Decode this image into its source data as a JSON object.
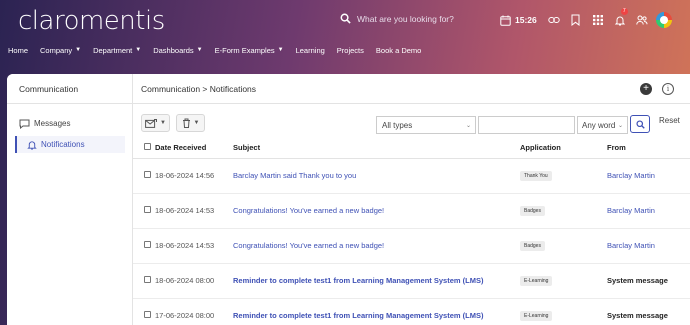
{
  "app": {
    "logo_text": "claromentis",
    "search_placeholder": "What are you looking for?",
    "clock_time": "15:26",
    "notification_count": "7"
  },
  "nav": {
    "items": [
      {
        "label": "Home",
        "has_menu": false
      },
      {
        "label": "Company",
        "has_menu": true
      },
      {
        "label": "Department",
        "has_menu": true
      },
      {
        "label": "Dashboards",
        "has_menu": true
      },
      {
        "label": "E-Form Examples",
        "has_menu": true
      },
      {
        "label": "Learning",
        "has_menu": false
      },
      {
        "label": "Projects",
        "has_menu": false
      },
      {
        "label": "Book a Demo",
        "has_menu": false
      }
    ]
  },
  "sidebar": {
    "title": "Communication",
    "items": [
      {
        "label": "Messages",
        "icon": "message-icon",
        "active": false
      },
      {
        "label": "Notifications",
        "icon": "bell-icon",
        "active": true
      }
    ]
  },
  "content": {
    "breadcrumb": "Communication > Notifications",
    "type_filter": "All types",
    "search_value": "",
    "match_mode": "Any word",
    "reset_label": "Reset"
  },
  "table": {
    "columns": [
      "Date Received",
      "Subject",
      "Application",
      "From"
    ],
    "rows": [
      {
        "date": "18-06-2024 14:56",
        "subject": "Barclay Martin said Thank you to you",
        "bold": false,
        "application": "Thank You",
        "from": "Barclay Martin",
        "from_link": true
      },
      {
        "date": "18-06-2024 14:53",
        "subject": "Congratulations! You've earned a new badge!",
        "bold": false,
        "application": "Badges",
        "from": "Barclay Martin",
        "from_link": true
      },
      {
        "date": "18-06-2024 14:53",
        "subject": "Congratulations! You've earned a new badge!",
        "bold": false,
        "application": "Badges",
        "from": "Barclay Martin",
        "from_link": true
      },
      {
        "date": "18-06-2024 08:00",
        "subject": "Reminder to complete test1 from Learning Management System (LMS)",
        "bold": true,
        "application": "E-Learning",
        "from": "System message",
        "from_link": false
      },
      {
        "date": "17-06-2024 08:00",
        "subject": "Reminder to complete test1 from Learning Management System (LMS)",
        "bold": true,
        "application": "E-Learning",
        "from": "System message",
        "from_link": false
      }
    ]
  },
  "colors": {
    "accent": "#3f51b5",
    "header_gradient_start": "#2b2352",
    "header_gradient_end": "#d77a54"
  }
}
